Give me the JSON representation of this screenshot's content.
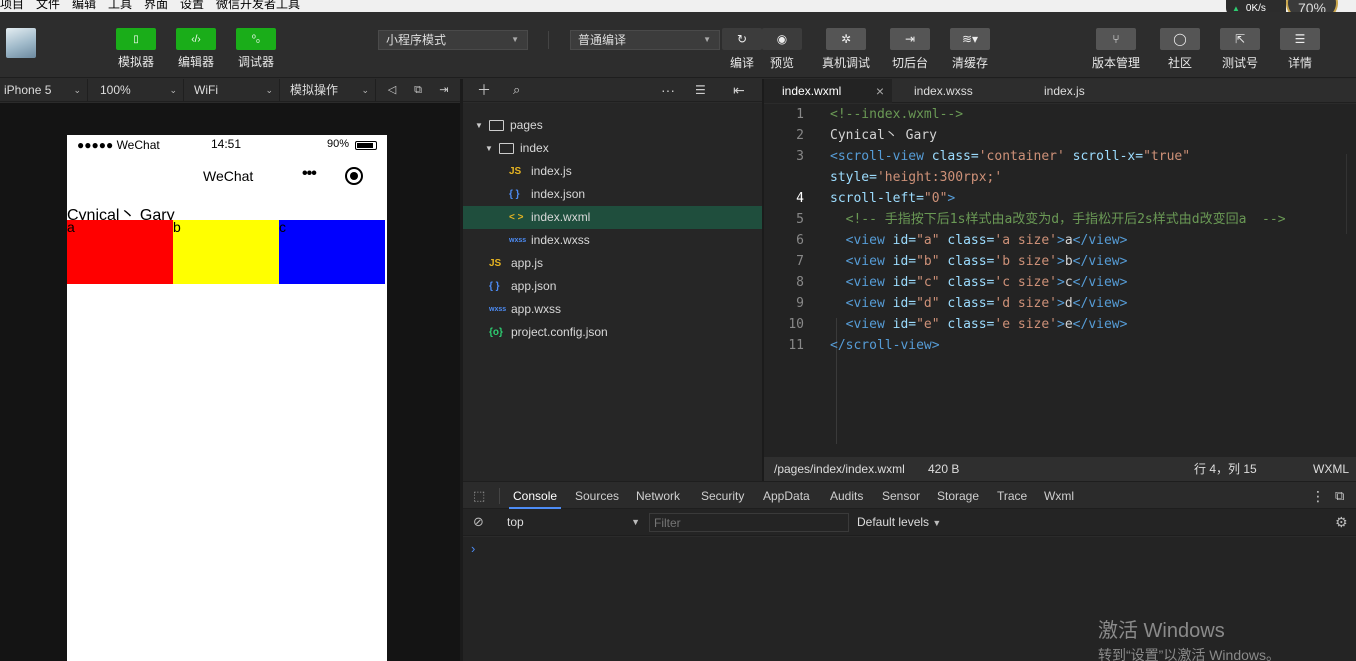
{
  "menu": [
    "项目",
    "文件",
    "编辑",
    "工具",
    "界面",
    "设置",
    "微信开发者工具"
  ],
  "netspeed": "0K/s",
  "cpu_badge": "70%",
  "toolbar": {
    "simulator": "模拟器",
    "editor": "编辑器",
    "debugger": "调试器",
    "mode_select": "小程序模式",
    "compile_select": "普通编译",
    "compile": "编译",
    "preview": "预览",
    "remote_debug": "真机调试",
    "background": "切后台",
    "clear_cache": "清缓存",
    "version": "版本管理",
    "community": "社区",
    "test_account": "测试号",
    "details": "详情"
  },
  "simbar": {
    "device": "iPhone 5",
    "zoom": "100%",
    "network": "WiFi",
    "operation": "模拟操作"
  },
  "phone": {
    "carrier": "●●●●● WeChat",
    "time": "14:51",
    "battery": "90%",
    "nav_title": "WeChat",
    "text": "Cynical丶 Gary",
    "boxes": [
      {
        "label": "a",
        "color": "#ff0000"
      },
      {
        "label": "b",
        "color": "#ffff00"
      },
      {
        "label": "c",
        "color": "#0000ff"
      }
    ]
  },
  "tree": {
    "pages": "pages",
    "index": "index",
    "files": [
      {
        "icon": "JS",
        "name": "index.js"
      },
      {
        "icon": "{ }",
        "name": "index.json"
      },
      {
        "icon": "< >",
        "name": "index.wxml"
      },
      {
        "icon": "wxss",
        "name": "index.wxss"
      },
      {
        "icon": "JS",
        "name": "app.js"
      },
      {
        "icon": "{ }",
        "name": "app.json"
      },
      {
        "icon": "wxss",
        "name": "app.wxss"
      },
      {
        "icon": "{o}",
        "name": "project.config.json"
      }
    ]
  },
  "tabs": [
    "index.wxml",
    "index.wxss",
    "index.js"
  ],
  "code_lines": {
    "l1": "<!--index.wxml-->",
    "l2": "Cynical丶 Gary",
    "l3a": "<scroll-view",
    "l3b": " class=",
    "l3c": "'container'",
    "l3d": " scroll-x=",
    "l3e": "\"true\"",
    "l3f": "style=",
    "l3g": "'height:300rpx;'",
    "l4a": "scroll-left=",
    "l4b": "\"0\"",
    "l4c": ">",
    "l5": "  <!-- 手指按下后1s样式由a改变为d，手指松开后2s样式由d改变回a  -->",
    "l10": "</scroll-view>",
    "views": [
      {
        "id": "\"a\"",
        "cls": "'a size'",
        "txt": "a"
      },
      {
        "id": "\"b\"",
        "cls": "'b size'",
        "txt": "b"
      },
      {
        "id": "\"c\"",
        "cls": "'c size'",
        "txt": "c"
      },
      {
        "id": "\"d\"",
        "cls": "'d size'",
        "txt": "d"
      },
      {
        "id": "\"e\"",
        "cls": "'e size'",
        "txt": "e"
      }
    ]
  },
  "line_numbers": [
    "1",
    "2",
    "3",
    "4",
    "5",
    "6",
    "7",
    "8",
    "9",
    "10",
    "11"
  ],
  "status": {
    "path": "/pages/index/index.wxml",
    "size": "420 B",
    "position": "行 4，列 15",
    "lang": "WXML"
  },
  "devtools": {
    "tabs": [
      "Console",
      "Sources",
      "Network",
      "Security",
      "AppData",
      "Audits",
      "Sensor",
      "Storage",
      "Trace",
      "Wxml"
    ],
    "context": "top",
    "filter_placeholder": "Filter",
    "levels": "Default levels"
  },
  "watermark": {
    "line1": "激活 Windows",
    "line2": "转到“设置”以激活 Windows。"
  }
}
